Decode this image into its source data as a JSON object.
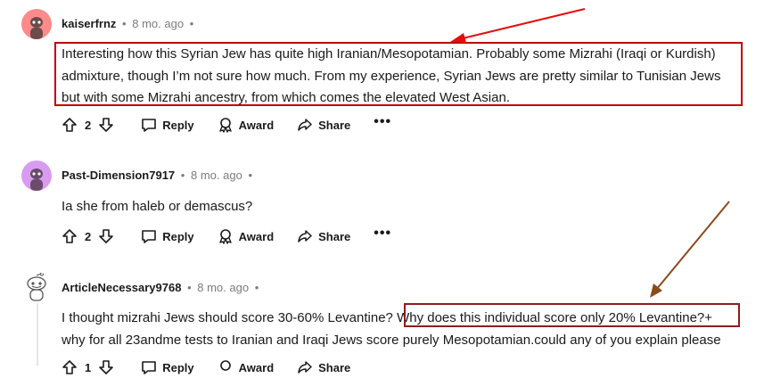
{
  "comments": [
    {
      "user": "kaiserfrnz",
      "time": "8 mo. ago",
      "lines": [
        "Interesting how this Syrian Jew has quite high Iranian/Mesopotamian. Probably some Mizrahi (Iraqi or Kurdish)",
        "admixture, though I’m not sure how much. From my experience, Syrian Jews are pretty similar to Tunisian Jews",
        "but with some Mizrahi ancestry, from which comes the elevated West Asian."
      ],
      "votes": "2",
      "avatar_color": "#ff8a8a"
    },
    {
      "user": "Past-Dimension7917",
      "time": "8 mo. ago",
      "lines": [
        "Ia she from haleb or demascus?"
      ],
      "votes": "2",
      "avatar_color": "#d79cf0"
    },
    {
      "user": "ArticleNecessary9768",
      "time": "8 mo. ago",
      "line1_start": "I thought mizrahi Jews should score 30-60% Levantine? ",
      "line1_highlight": "Why does this individual score only 20% Levantine?+",
      "line2": "why for all 23andme tests to Iranian and Iraqi Jews score purely Mesopotamian.could any of you explain please",
      "votes": "1",
      "avatar_color": "#ffffff"
    }
  ],
  "actions": {
    "reply": "Reply",
    "award": "Award",
    "share": "Share",
    "more": "•••"
  },
  "separator": "•",
  "annotation_color": "#c00000",
  "arrow_colors": [
    "#e01010",
    "#8b4a1a"
  ]
}
